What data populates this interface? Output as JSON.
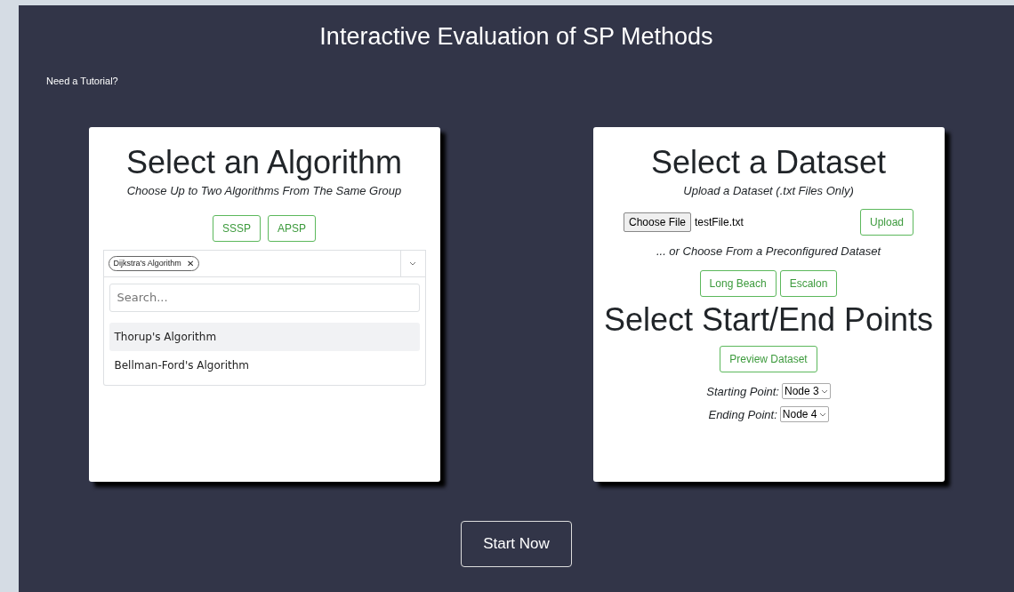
{
  "title": "Interactive Evaluation of SP Methods",
  "tutorial_link": "Need a Tutorial?",
  "algorithm_card": {
    "heading": "Select an Algorithm",
    "subtitle": "Choose Up to Two Algorithms From The Same Group",
    "group_buttons": [
      "SSSP",
      "APSP"
    ],
    "chosen": [
      {
        "label": "Dijkstra's Algorithm",
        "remove": "✕"
      }
    ],
    "dropdown": {
      "expanded": true,
      "search_placeholder": "Search...",
      "options": [
        {
          "label": "Thorup's Algorithm",
          "highlighted": true
        },
        {
          "label": "Bellman-Ford's Algorithm",
          "highlighted": false
        }
      ]
    }
  },
  "dataset_card": {
    "heading": "Select a Dataset",
    "subtitle": "Upload a Dataset (.txt Files Only)",
    "file_button": "Choose File",
    "file_name": "testFile.txt",
    "upload_button": "Upload",
    "preconfigured_text": "... or Choose From a Preconfigured Dataset",
    "dataset_buttons": [
      "Long Beach",
      "Escalon"
    ],
    "points_heading": "Select Start/End Points",
    "preview_button": "Preview Dataset",
    "points": [
      {
        "label": "Starting Point:",
        "value": "Node 3"
      },
      {
        "label": "Ending Point:",
        "value": "Node 4"
      }
    ]
  },
  "start_button": "Start Now"
}
